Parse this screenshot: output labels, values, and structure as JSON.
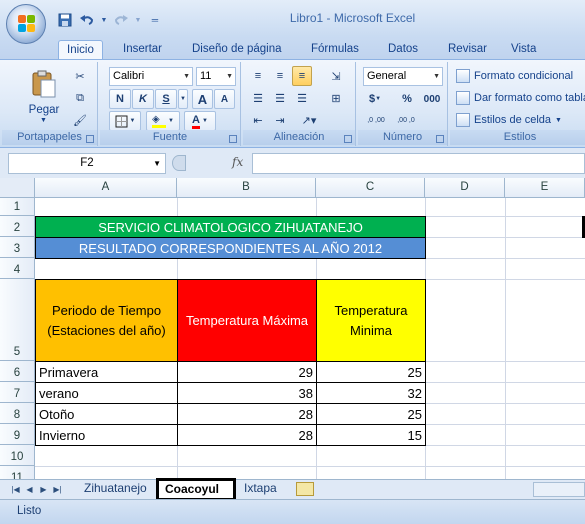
{
  "window": {
    "title": "Libro1 - Microsoft Excel"
  },
  "qat": {
    "save_icon": "save-icon",
    "undo_icon": "undo-icon",
    "redo_icon": "redo-icon",
    "customize_icon": "customize-qat-icon"
  },
  "ribbon": {
    "tabs": [
      "Inicio",
      "Insertar",
      "Diseño de página",
      "Fórmulas",
      "Datos",
      "Revisar",
      "Vista"
    ],
    "active_tab": "Inicio",
    "groups": {
      "clipboard": {
        "label": "Portapapeles",
        "paste_label": "Pegar"
      },
      "font": {
        "label": "Fuente",
        "font_name": "Calibri",
        "font_size": "11",
        "bold": "N",
        "italic": "K",
        "underline": "S",
        "grow": "A",
        "shrink": "A"
      },
      "alignment": {
        "label": "Alineación"
      },
      "number": {
        "label": "Número",
        "format": "General",
        "currency": "$",
        "percent": "%",
        "thousands": "000",
        "inc_decimal": ",0 ,00",
        "dec_decimal": ",00 ,0"
      },
      "styles": {
        "label": "Estilos",
        "conditional": "Formato condicional",
        "as_table": "Dar formato como tabla",
        "cell_styles": "Estilos de celda"
      }
    }
  },
  "formula_bar": {
    "name_box": "F2",
    "fx": "fx",
    "formula": ""
  },
  "grid": {
    "columns": [
      "A",
      "B",
      "C",
      "D",
      "E"
    ],
    "rows": [
      "1",
      "2",
      "3",
      "4",
      "5",
      "6",
      "7",
      "8",
      "9",
      "10",
      "11"
    ],
    "title1": "SERVICIO CLIMATOLOGICO ZIHUATANEJO",
    "title2": "RESULTADO CORRESPONDIENTES AL AÑO 2012",
    "header_period": "Periodo de Tiempo (Estaciones del año)",
    "header_max": "Temperatura Máxima",
    "header_min": "Temperatura Minima",
    "data": [
      {
        "season": "Primavera",
        "max": "29",
        "min": "25"
      },
      {
        "season": "verano",
        "max": "38",
        "min": "32"
      },
      {
        "season": "Otoño",
        "max": "28",
        "min": "25"
      },
      {
        "season": "Invierno",
        "max": "28",
        "min": "15"
      }
    ],
    "colors": {
      "title1_bg": "#00b050",
      "title2_bg": "#558ed5",
      "period_bg": "#ffc000",
      "max_bg": "#ff0000",
      "min_bg": "#ffff00"
    }
  },
  "sheets": {
    "tabs": [
      "Zihuatanejo",
      "Coacoyul",
      "Ixtapa"
    ],
    "active": "Coacoyul"
  },
  "status": {
    "text": "Listo"
  }
}
